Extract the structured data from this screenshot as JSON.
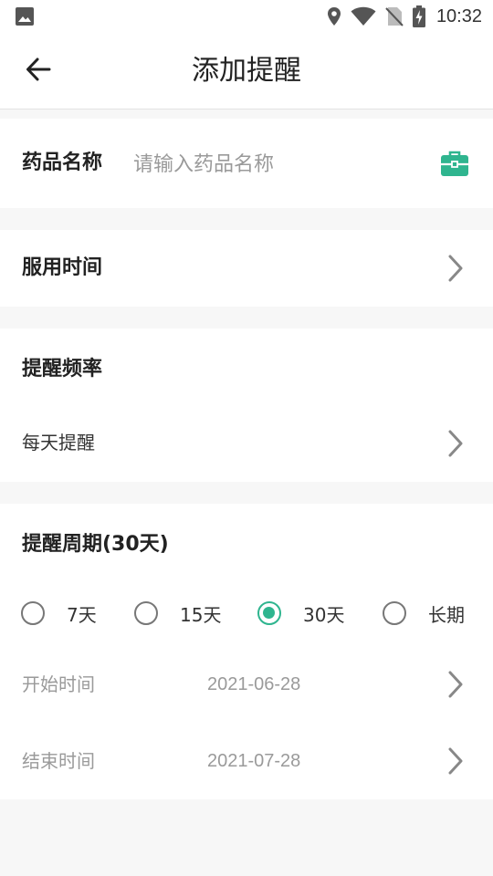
{
  "status_bar": {
    "time": "10:32",
    "icons": [
      "image-icon",
      "location-icon",
      "wifi-icon",
      "no-sim-icon",
      "battery-charging-icon"
    ]
  },
  "app_bar": {
    "title": "添加提醒",
    "back_icon": "arrow-left-icon"
  },
  "drug": {
    "label": "药品名称",
    "value": "",
    "placeholder": "请输入药品名称",
    "icon": "medicine-kit-icon"
  },
  "dose_time": {
    "label": "服用时间"
  },
  "frequency": {
    "title": "提醒频率",
    "value": "每天提醒"
  },
  "period": {
    "title": "提醒周期(30天)",
    "options": [
      {
        "label": "7天",
        "checked": false
      },
      {
        "label": "15天",
        "checked": false
      },
      {
        "label": "30天",
        "checked": true
      },
      {
        "label": "长期",
        "checked": false
      }
    ],
    "start": {
      "label": "开始时间",
      "value": "2021-06-28"
    },
    "end": {
      "label": "结束时间",
      "value": "2021-07-28"
    }
  },
  "colors": {
    "accent": "#2fb58f",
    "page_background": "#f7f7f7",
    "muted_text": "#9a9a9a"
  }
}
